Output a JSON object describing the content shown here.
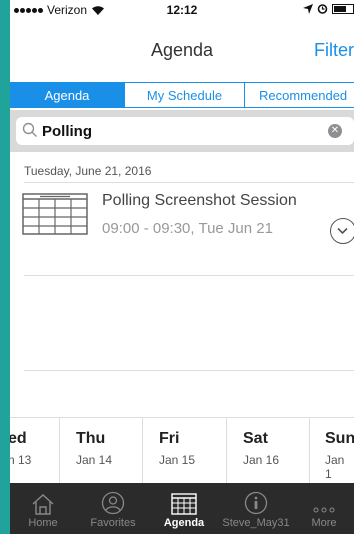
{
  "status_bar": {
    "carrier": "Verizon",
    "time": "12:12"
  },
  "nav": {
    "title": "Agenda",
    "filter_label": "Filter"
  },
  "segments": [
    {
      "label": "Agenda",
      "active": true
    },
    {
      "label": "My Schedule",
      "active": false
    },
    {
      "label": "Recommended",
      "active": false
    }
  ],
  "search": {
    "value": "Polling",
    "placeholder": ""
  },
  "date_header": "Tuesday, June 21, 2016",
  "session": {
    "title": "Polling Screenshot Session",
    "time": "09:00 - 09:30, Tue Jun 21"
  },
  "days": [
    {
      "name": "ed",
      "date": "n 13"
    },
    {
      "name": "Thu",
      "date": "Jan 14"
    },
    {
      "name": "Fri",
      "date": "Jan 15"
    },
    {
      "name": "Sat",
      "date": "Jan 16"
    },
    {
      "name": "Sun",
      "date": "Jan 1"
    }
  ],
  "tabs": [
    {
      "label": "Home",
      "icon": "home-icon",
      "active": false
    },
    {
      "label": "Favorites",
      "icon": "person-icon",
      "active": false
    },
    {
      "label": "Agenda",
      "icon": "calendar-icon",
      "active": true
    },
    {
      "label": "Steve_May31",
      "icon": "info-icon",
      "active": false
    },
    {
      "label": "More",
      "icon": "more-icon",
      "active": false
    }
  ],
  "colors": {
    "accent": "#1a8fe8",
    "tab_bar": "#2b2b2b",
    "background": "#1fa39a"
  }
}
